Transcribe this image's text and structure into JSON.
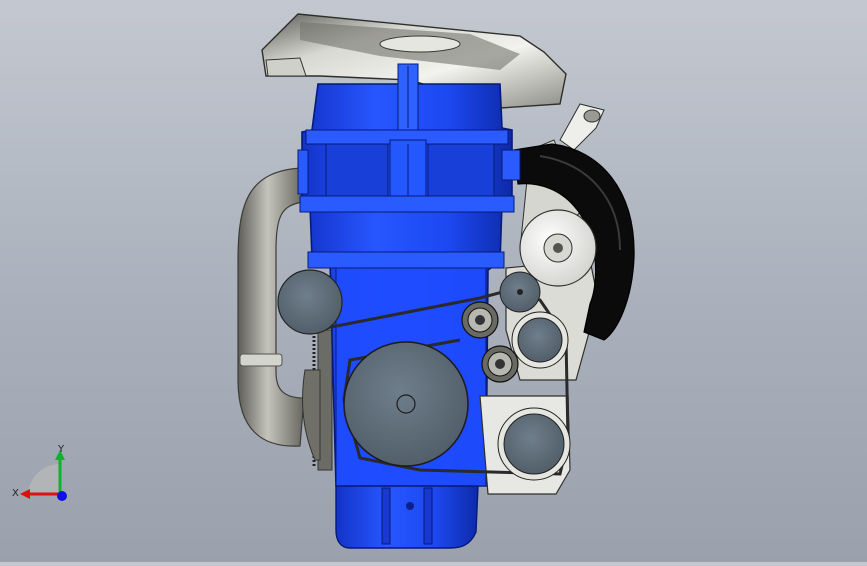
{
  "viewport": {
    "background_top": "#c3c8d0",
    "background_bottom": "#9aa1ad"
  },
  "model": {
    "block_color": "#1f4cff",
    "block_dark": "#0f2fb8",
    "pulley_color": "#5c6b78",
    "belt_color": "#2a2a2a",
    "metal_color": "#c9c9c4",
    "hose_color": "#0c0c0c",
    "pipe_color": "#8a8a83"
  },
  "triad": {
    "x_label": "X",
    "y_label": "Y",
    "x_color": "#e01010",
    "y_color": "#10b030",
    "z_color": "#1010e0"
  }
}
